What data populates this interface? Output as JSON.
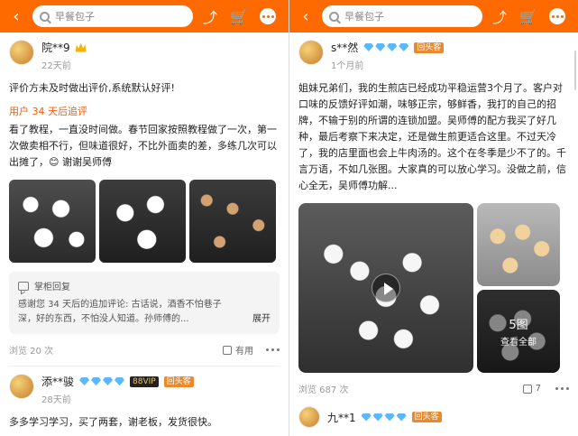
{
  "search": {
    "placeholder": "早餐包子"
  },
  "left": {
    "user1": {
      "name": "院**9",
      "time": "22天前",
      "comment": "评价方未及时做出评价,系统默认好评!",
      "add_label": "用户 34 天后追评",
      "add_text": "看了教程，一直没时间做。春节回家按照教程做了一次，第一次做卖相不行，但味道很好，不比外面卖的差，多练几次可以出摊了，😊 谢谢吴师傅",
      "reply_title": "掌柜回复",
      "reply_text": "感谢您 34 天后的追加评论: 古话说，酒香不怕巷子深，好的东西，不怕没人知道。孙师傅的...",
      "expand": "展开",
      "views": "浏览 20 次",
      "useful": "有用"
    },
    "user2": {
      "name": "添**骏",
      "time": "28天前",
      "vip": "88VIP",
      "tag": "回头客",
      "comment": "多多学习学习，买了两套，谢老板，发货很快。"
    }
  },
  "right": {
    "user1": {
      "name": "s**然",
      "time": "1个月前",
      "tag": "回头客",
      "comment": "姐妹兄弟们，我的生煎店已经成功平稳运营3个月了。客户对口味的反馈好评如潮，味够正宗，够鲜香，我打的自己的招牌，不输于别的所谓的连锁加盟。吴师傅的配方我买了好几种，最后考察下来决定，还是做生煎更适合这里。不过天冷了，我的店里面也会上牛肉汤的。这个在冬季是少不了的。千言万语，不如几张图。大家真的可以放心学习。没做之前，信心全无，吴师傅功解...",
      "images_count": "5图",
      "view_all": "查看全部",
      "views": "浏览 687 次",
      "likes": "7"
    },
    "user2": {
      "name": "九**1",
      "tag": "回头客"
    }
  }
}
